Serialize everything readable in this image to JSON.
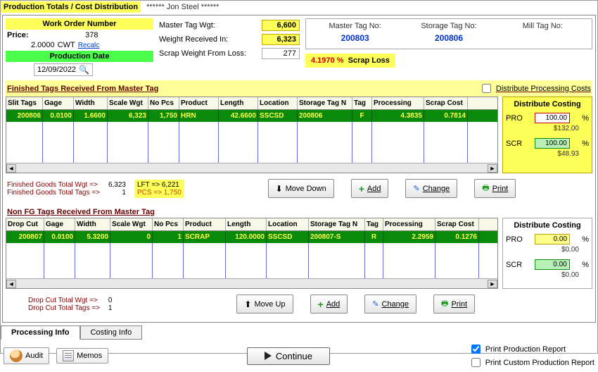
{
  "title": {
    "left": "Production Totals / Cost Distribution",
    "right": "****** Jon Steel ******"
  },
  "wo": {
    "header": "Work Order Number",
    "number": "378",
    "price_label": "Price:",
    "price": "2.0000",
    "unit": "CWT",
    "recalc": "Recalc",
    "prod_date_label": "Production Date",
    "prod_date": "12/09/2022"
  },
  "weights": {
    "master_label": "Master Tag Wgt:",
    "master_val": "6,600",
    "recv_label": "Weight Received In:",
    "recv_val": "6,323",
    "scrap_label": "Scrap Weight From Loss:",
    "scrap_val": "277"
  },
  "tagnos": {
    "master_label": "Master Tag No:",
    "master_val": "200803",
    "storage_label": "Storage Tag No:",
    "storage_val": "200806",
    "mill_label": "Mill Tag No:",
    "mill_val": ""
  },
  "scrap_loss": {
    "pct": "4.1970 %",
    "label": "Scrap Loss"
  },
  "fin_section": {
    "header": "Finished Tags Received From Master Tag",
    "dist_chk": "Distribute Processing Costs",
    "cols": [
      "Slit Tags",
      "Gage",
      "Width",
      "Scale Wgt",
      "No Pcs",
      "Product",
      "Length",
      "Location",
      "Storage Tag N",
      "Tag",
      "Processing",
      "Scrap Cost"
    ],
    "row": [
      "200806",
      "0.0100",
      "1.6600",
      "6,323",
      "1,750",
      "HRN",
      "42.6600",
      "SSCSD",
      "200806",
      "F",
      "4.3835",
      "0.7814"
    ],
    "fin_total_wgt_lbl": "Finished Goods Total Wgt =>",
    "fin_total_wgt": "6,323",
    "fin_total_tags_lbl": "Finished Goods Total Tags =>",
    "fin_total_tags": "1",
    "lft_lbl": "LFT =>",
    "lft": "6,221",
    "pcs_lbl": "PCS =>",
    "pcs": "1,750"
  },
  "nonfg_section": {
    "header": "Non FG Tags Received From Master Tag",
    "cols": [
      "Drop Cut",
      "Gage",
      "Width",
      "Scale Wgt",
      "No Pcs",
      "Product",
      "Length",
      "Location",
      "Storage Tag N",
      "Tag",
      "Processing",
      "Scrap Cost"
    ],
    "row": [
      "200807",
      "0.0100",
      "5.3200",
      "0",
      "1",
      "SCRAP",
      "120.0000",
      "SSCSD",
      "200807-S",
      "R",
      "2.2959",
      "0.1276"
    ],
    "drop_wgt_lbl": "Drop Cut Total Wgt =>",
    "drop_wgt": "0",
    "drop_tags_lbl": "Drop Cut Total Tags =>",
    "drop_tags": "1"
  },
  "dist_top": {
    "title": "Distribute Costing",
    "pro": "PRO",
    "pro_val": "100.00",
    "pro_amt": "$132.00",
    "scr": "SCR",
    "scr_val": "100.00",
    "scr_amt": "$48.93",
    "pct": "%"
  },
  "dist_bot": {
    "title": "Distribute Costing",
    "pro": "PRO",
    "pro_val": "0.00",
    "pro_amt": "$0.00",
    "scr": "SCR",
    "scr_val": "0.00",
    "scr_amt": "$0.00",
    "pct": "%"
  },
  "buttons": {
    "move_down": "Move Down",
    "move_up": "Move Up",
    "add": "Add",
    "change": "Change",
    "print": "Print"
  },
  "tabs": {
    "processing": "Processing Info",
    "costing": "Costing Info"
  },
  "footer": {
    "audit": "Audit",
    "memos": "Memos",
    "continue": "Continue",
    "print_prod": "Print Production Report",
    "print_custom": "Print Custom Production Report"
  }
}
